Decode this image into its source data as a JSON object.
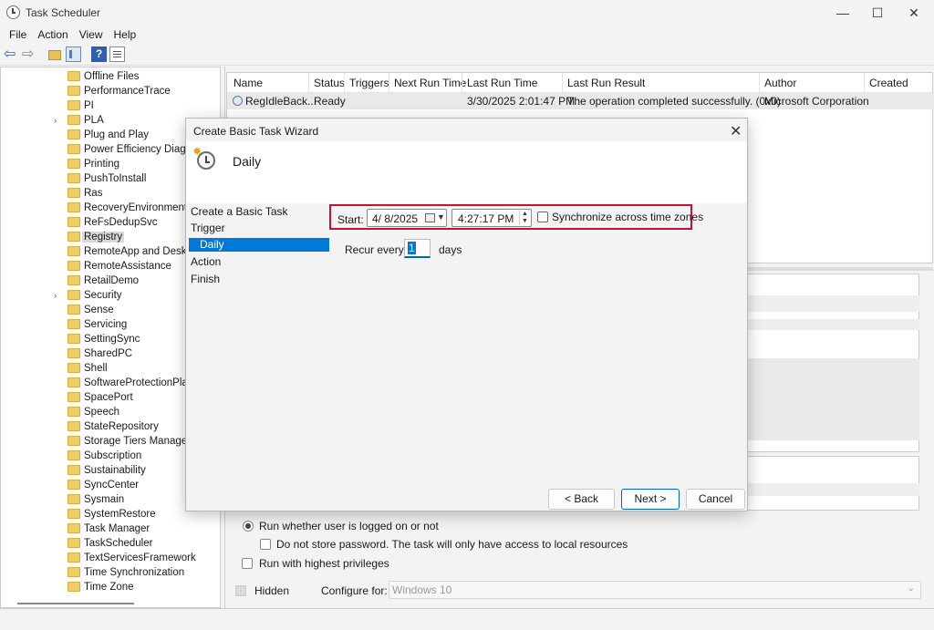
{
  "window": {
    "title": "Task Scheduler",
    "minimize": "—",
    "maximize": "☐",
    "close": "✕"
  },
  "menu": [
    "File",
    "Action",
    "View",
    "Help"
  ],
  "toolbar": {
    "help": "?",
    "back": "⇦",
    "forward": "⇨"
  },
  "tree": {
    "items": [
      {
        "label": "Offline Files",
        "expander": ""
      },
      {
        "label": "PerformanceTrace",
        "expander": ""
      },
      {
        "label": "PI",
        "expander": ""
      },
      {
        "label": "PLA",
        "expander": "›"
      },
      {
        "label": "Plug and Play",
        "expander": ""
      },
      {
        "label": "Power Efficiency Diagnostics",
        "expander": ""
      },
      {
        "label": "Printing",
        "expander": ""
      },
      {
        "label": "PushToInstall",
        "expander": ""
      },
      {
        "label": "Ras",
        "expander": ""
      },
      {
        "label": "RecoveryEnvironment",
        "expander": ""
      },
      {
        "label": "ReFsDedupSvc",
        "expander": ""
      },
      {
        "label": "Registry",
        "expander": "",
        "selected": true
      },
      {
        "label": "RemoteApp and Desktop Connections Update",
        "expander": ""
      },
      {
        "label": "RemoteAssistance",
        "expander": ""
      },
      {
        "label": "RetailDemo",
        "expander": ""
      },
      {
        "label": "Security",
        "expander": "›"
      },
      {
        "label": "Sense",
        "expander": ""
      },
      {
        "label": "Servicing",
        "expander": ""
      },
      {
        "label": "SettingSync",
        "expander": ""
      },
      {
        "label": "SharedPC",
        "expander": ""
      },
      {
        "label": "Shell",
        "expander": ""
      },
      {
        "label": "SoftwareProtectionPlatform",
        "expander": ""
      },
      {
        "label": "SpacePort",
        "expander": ""
      },
      {
        "label": "Speech",
        "expander": ""
      },
      {
        "label": "StateRepository",
        "expander": ""
      },
      {
        "label": "Storage Tiers Management",
        "expander": ""
      },
      {
        "label": "Subscription",
        "expander": ""
      },
      {
        "label": "Sustainability",
        "expander": ""
      },
      {
        "label": "SyncCenter",
        "expander": ""
      },
      {
        "label": "Sysmain",
        "expander": ""
      },
      {
        "label": "SystemRestore",
        "expander": ""
      },
      {
        "label": "Task Manager",
        "expander": ""
      },
      {
        "label": "TaskScheduler",
        "expander": ""
      },
      {
        "label": "TextServicesFramework",
        "expander": ""
      },
      {
        "label": "Time Synchronization",
        "expander": ""
      },
      {
        "label": "Time Zone",
        "expander": ""
      }
    ]
  },
  "grid": {
    "columns": [
      "Name",
      "Status",
      "Triggers",
      "Next Run Time",
      "Last Run Time",
      "Last Run Result",
      "Author",
      "Created"
    ],
    "row": {
      "name": "RegIdleBack...",
      "status": "Ready",
      "triggers": "",
      "next_run": "",
      "last_run": "3/30/2025 2:01:47 PM",
      "result": "The operation completed successfully. (0x0)",
      "author": "Microsoft Corporation",
      "created": ""
    }
  },
  "bottom": {
    "run_whether": "Run whether user is logged on or not",
    "no_store_pw": "Do not store password.  The task will only have access to local resources",
    "highest": "Run with highest privileges",
    "hidden": "Hidden",
    "configure_label": "Configure for:",
    "configure_value": "Windows 10",
    "combo_arrow": "⌄"
  },
  "dialog": {
    "title": "Create Basic Task Wizard",
    "close": "✕",
    "heading": "Daily",
    "steps": [
      "Create a Basic Task",
      "Trigger",
      "Daily",
      "Action",
      "Finish"
    ],
    "active_step": "Daily",
    "start_label": "Start:",
    "date_value": "4/  8/2025",
    "date_dropdown": "▼",
    "time_value": "4:27:17 PM",
    "spin_up": "▲",
    "spin_down": "▼",
    "sync_label": "Synchronize across time zones",
    "recur_label": "Recur every:",
    "recur_value": "1",
    "days_label": "days",
    "back": "< Back",
    "next": "Next >",
    "cancel": "Cancel",
    "star": "✸"
  },
  "colors": {
    "accent": "#0078d7",
    "highlight": "#c8102e",
    "folder": "#f1cd6a"
  }
}
